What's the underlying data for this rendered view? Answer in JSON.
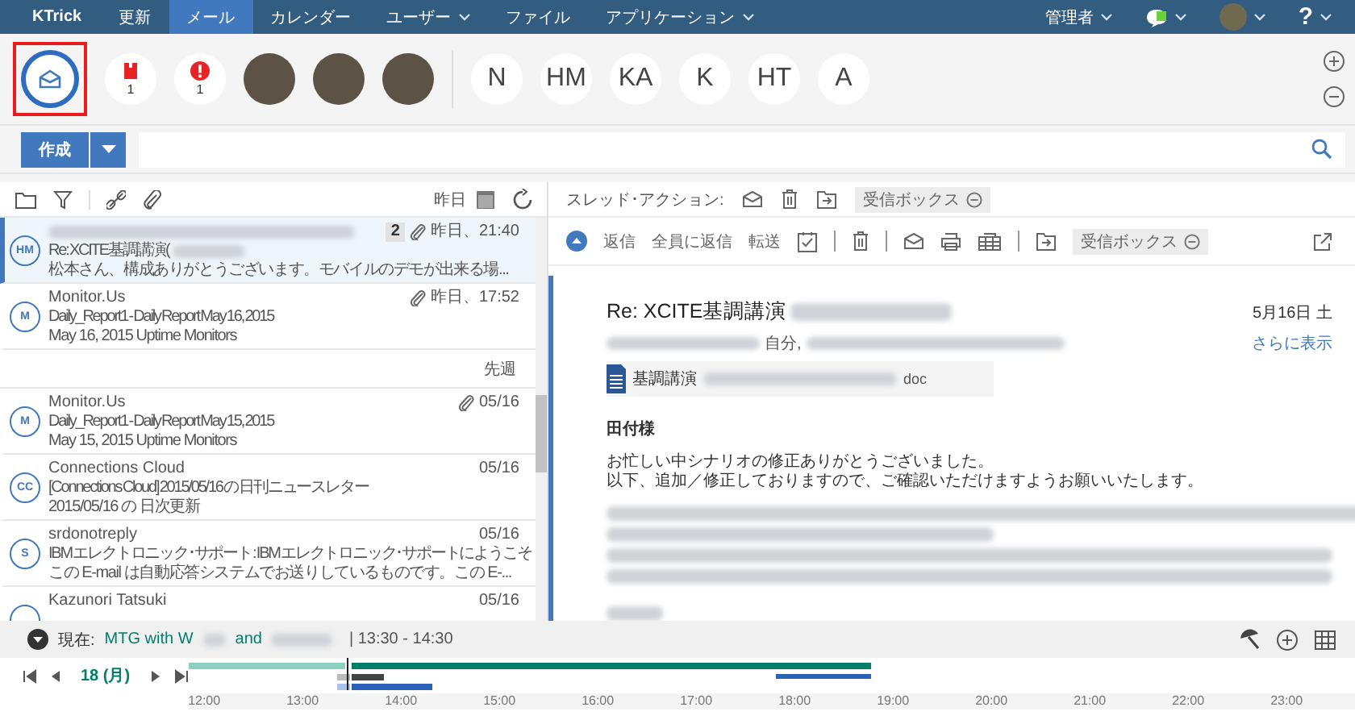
{
  "nav": {
    "brand": "KTrick",
    "items": [
      {
        "label": "更新",
        "selected": false,
        "dropdown": false
      },
      {
        "label": "メール",
        "selected": true,
        "dropdown": false
      },
      {
        "label": "カレンダー",
        "selected": false,
        "dropdown": false
      },
      {
        "label": "ユーザー",
        "selected": false,
        "dropdown": true
      },
      {
        "label": "ファイル",
        "selected": false,
        "dropdown": false
      },
      {
        "label": "アプリケーション",
        "selected": false,
        "dropdown": true
      }
    ],
    "right": [
      {
        "kind": "text",
        "label": "管理者"
      },
      {
        "kind": "status"
      },
      {
        "kind": "avatar"
      },
      {
        "kind": "help",
        "label": "?"
      }
    ]
  },
  "people": [
    {
      "kind": "mail",
      "selected": true
    },
    {
      "kind": "tag",
      "count": "1",
      "selected": false
    },
    {
      "kind": "alert",
      "count": "1",
      "selected": false
    },
    {
      "kind": "photo",
      "selected": false
    },
    {
      "kind": "photo",
      "selected": false
    },
    {
      "kind": "photo",
      "selected": false
    },
    {
      "kind": "initials",
      "label": "N",
      "selected": false
    },
    {
      "kind": "initials",
      "label": "HM",
      "selected": false
    },
    {
      "kind": "initials",
      "label": "KA",
      "selected": false
    },
    {
      "kind": "initials",
      "label": "K",
      "selected": false
    },
    {
      "kind": "initials",
      "label": "HT",
      "selected": false
    },
    {
      "kind": "initials",
      "label": "A",
      "selected": false
    }
  ],
  "compose": {
    "button": "作成"
  },
  "list_toolbar": {
    "date_label": "昨日"
  },
  "messages": [
    {
      "kind": "message",
      "initials": "HM",
      "sender_blurred": true,
      "subject": "Re: XCITE基調講演(",
      "subject_blurred": true,
      "preview": "松本さん、構成ありがとうございます。モバイルのデモが出来る場...",
      "count": "2",
      "attachment": true,
      "date": "昨日、21:40",
      "selected": true
    },
    {
      "kind": "message",
      "initials": "M",
      "sender": "Monitor.Us",
      "subject": "Daily_Report1 - Daily Report May 16, 2015",
      "preview": "May 16, 2015 Uptime Monitors",
      "attachment": true,
      "date": "昨日、17:52",
      "selected": false
    },
    {
      "kind": "separator",
      "label": "先週"
    },
    {
      "kind": "message",
      "initials": "M",
      "sender": "Monitor.Us",
      "subject": "Daily_Report1 - Daily Report May 15, 2015",
      "preview": "May 15, 2015 Uptime Monitors",
      "attachment": true,
      "date": "05/16",
      "selected": false
    },
    {
      "kind": "message",
      "initials": "CC",
      "sender": "Connections Cloud",
      "subject": "[Connections Cloud] 2015/05/16 の 日刊ニュースレター",
      "preview": "2015/05/16 の 日次更新",
      "attachment": false,
      "date": "05/16",
      "selected": false
    },
    {
      "kind": "message",
      "initials": "S",
      "sender": "srdonotreply",
      "subject": "IBM エレクトロニック･サポート : IBM エレクトロニック･サポートにようこそ",
      "preview": "この E-mail は自動応答システムでお送りしているものです。この E-...",
      "attachment": false,
      "date": "05/16",
      "selected": false
    },
    {
      "kind": "message",
      "sender": "Kazunori Tatsuki",
      "attachment": false,
      "date": "05/16",
      "selected": false
    }
  ],
  "thread_actions": {
    "label": "スレッド･アクション:",
    "folder": "受信ボックス"
  },
  "reader": {
    "actions": [
      "返信",
      "全員に返信",
      "転送"
    ],
    "folder": "受信ボックス",
    "subject": "Re: XCITE基調講演",
    "subject_blurred": true,
    "date": "5月16日 土",
    "more": "さらに表示",
    "recipients": "自分,",
    "attachment": {
      "name": "基調講演",
      "ext": "doc"
    },
    "greeting": "田付様",
    "lines": [
      "お忙しい中シナリオの修正ありがとうございました。",
      "以下、追加／修正しておりますので、ご確認いただけますようお願いいたします。"
    ]
  },
  "now": {
    "label": "現在:",
    "title": "MTG with W",
    "joiner": "and",
    "time": "| 13:30 - 14:30"
  },
  "timeline": {
    "date": "18 (月)",
    "hours": [
      "12:00",
      "13:00",
      "14:00",
      "15:00",
      "16:00",
      "17:00",
      "18:00",
      "19:00",
      "20:00",
      "21:00",
      "22:00",
      "23:00"
    ]
  }
}
